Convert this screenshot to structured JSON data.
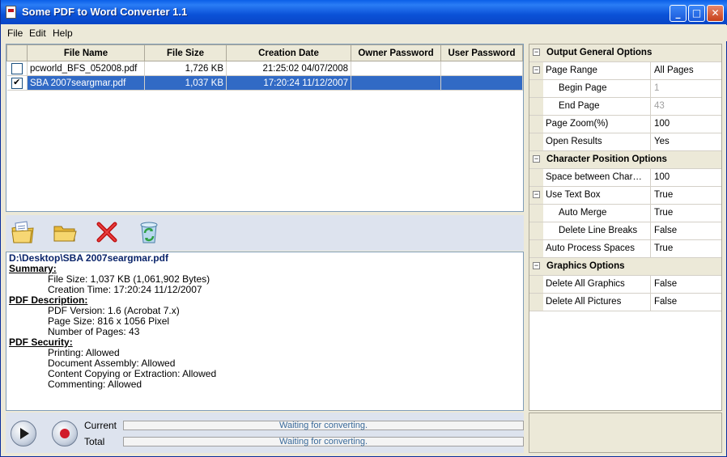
{
  "window": {
    "title": "Some PDF to Word Converter 1.1",
    "controls": {
      "minimize": "_",
      "maximize": "□",
      "close": "✕"
    }
  },
  "menu": [
    "File",
    "Edit",
    "Help"
  ],
  "file_table": {
    "columns": [
      "File Name",
      "File Size",
      "Creation Date",
      "Owner Password",
      "User Password"
    ],
    "rows": [
      {
        "checked": false,
        "name": "pcworld_BFS_052008.pdf",
        "size": "1,726 KB",
        "date": "21:25:02 04/07/2008",
        "owner_password": "",
        "user_password": "",
        "selected": false
      },
      {
        "checked": true,
        "name": "SBA 2007seargmar.pdf",
        "size": "1,037 KB",
        "date": "17:20:24 11/12/2007",
        "owner_password": "",
        "user_password": "",
        "selected": true
      }
    ]
  },
  "toolbar": {
    "icons": [
      "add-file-icon",
      "open-folder-icon",
      "delete-icon",
      "clear-recycle-icon"
    ]
  },
  "info": {
    "path": "D:\\Desktop\\SBA 2007seargmar.pdf",
    "summary_title": "Summary:",
    "summary": [
      "File Size: 1,037 KB (1,061,902 Bytes)",
      "Creation Time: 17:20:24 11/12/2007"
    ],
    "description_title": "PDF Description:",
    "description": [
      "PDF Version: 1.6 (Acrobat 7.x)",
      "Page Size: 816 x 1056 Pixel",
      "Number of Pages: 43"
    ],
    "security_title": "PDF Security:",
    "security": [
      "Printing: Allowed",
      "Document Assembly: Allowed",
      "Content Copying or Extraction: Allowed",
      "Commenting: Allowed"
    ]
  },
  "status": {
    "current_label": "Current",
    "total_label": "Total",
    "current_text": "Waiting for converting.",
    "total_text": "Waiting for converting."
  },
  "properties": [
    {
      "type": "category",
      "label": "Output General Options"
    },
    {
      "type": "prop",
      "name": "Page Range",
      "value": "All Pages",
      "expander": "−"
    },
    {
      "type": "prop",
      "name": "Begin Page",
      "value": "1",
      "indent": true,
      "disabled": true
    },
    {
      "type": "prop",
      "name": "End Page",
      "value": "43",
      "indent": true,
      "disabled": true
    },
    {
      "type": "prop",
      "name": "Page Zoom(%)",
      "value": "100"
    },
    {
      "type": "prop",
      "name": "Open Results",
      "value": "Yes"
    },
    {
      "type": "category",
      "label": "Character Position Options"
    },
    {
      "type": "prop",
      "name": "Space between Char…",
      "value": "100"
    },
    {
      "type": "prop",
      "name": "Use Text Box",
      "value": "True",
      "expander": "−"
    },
    {
      "type": "prop",
      "name": "Auto Merge",
      "value": "True",
      "indent": true
    },
    {
      "type": "prop",
      "name": "Delete Line Breaks",
      "value": "False",
      "indent": true
    },
    {
      "type": "prop",
      "name": "Auto Process Spaces",
      "value": "True"
    },
    {
      "type": "category",
      "label": "Graphics Options"
    },
    {
      "type": "prop",
      "name": "Delete All Graphics",
      "value": "False"
    },
    {
      "type": "prop",
      "name": "Delete All Pictures",
      "value": "False"
    }
  ]
}
